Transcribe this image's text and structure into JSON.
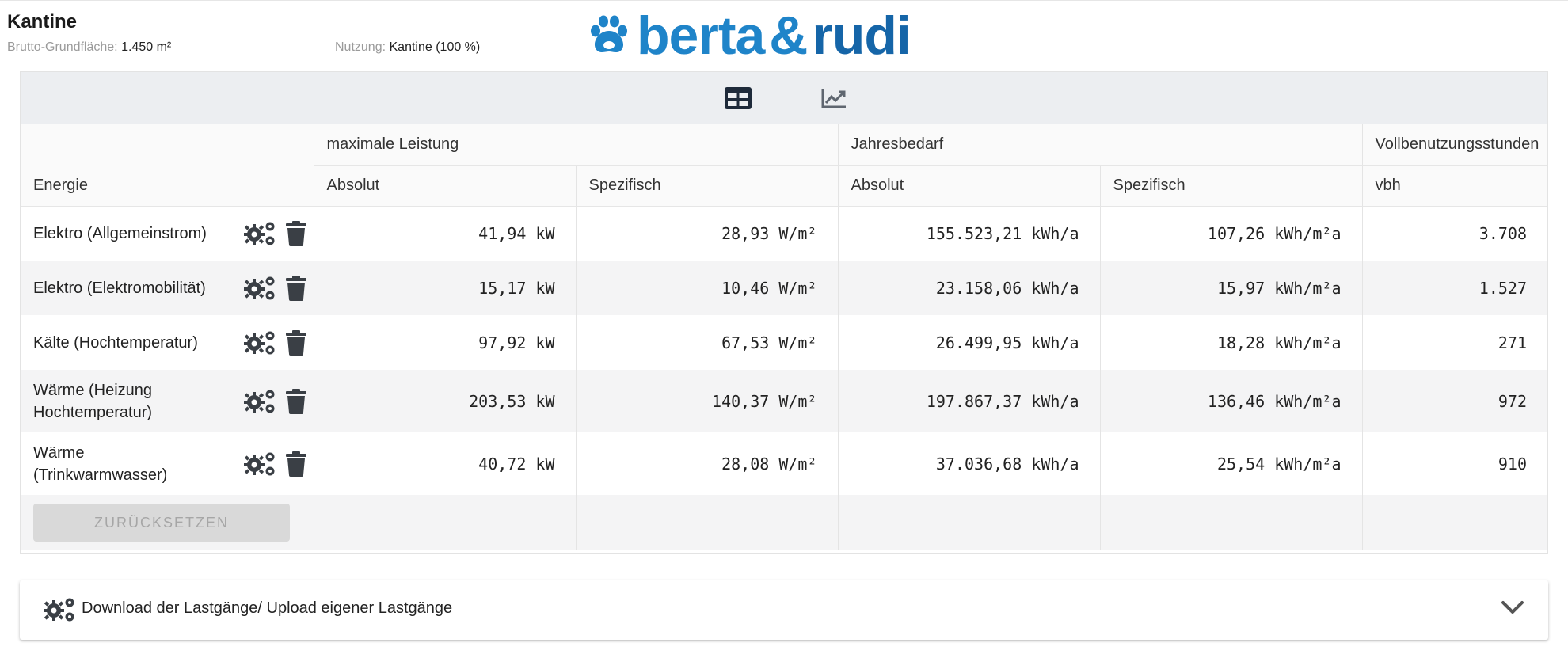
{
  "building": {
    "title": "Kantine",
    "area_label": "Brutto-Grundfläche:",
    "area_value": "1.450 m²",
    "usage_label": "Nutzung:",
    "usage_value": "Kantine (100 %)"
  },
  "logo": {
    "part1": "berta",
    "amp": "&",
    "part2": "rudi",
    "color": "#1f84c9"
  },
  "toolbar": {
    "table_icon": "table-icon",
    "chart_icon": "line-chart-icon",
    "active": "table"
  },
  "table": {
    "group_headers": {
      "energy": "Energie",
      "max_power": "maximale Leistung",
      "annual": "Jahresbedarf",
      "full_hours": "Vollbenutzungsstunden"
    },
    "sub_headers": {
      "abs1": "Absolut",
      "spec1": "Spezifisch",
      "abs2": "Absolut",
      "spec2": "Spezifisch",
      "vbh": "vbh"
    },
    "rows": [
      {
        "name": "Elektro (Allgemeinstrom)",
        "p_abs": "41,94 kW",
        "p_spec": "28,93 W/m²",
        "a_abs": "155.523,21 kWh/a",
        "a_spec": "107,26 kWh/m²a",
        "vbh": "3.708"
      },
      {
        "name": "Elektro (Elektromobilität)",
        "p_abs": "15,17 kW",
        "p_spec": "10,46 W/m²",
        "a_abs": "23.158,06 kWh/a",
        "a_spec": "15,97 kWh/m²a",
        "vbh": "1.527"
      },
      {
        "name": "Kälte (Hochtemperatur)",
        "p_abs": "97,92 kW",
        "p_spec": "67,53 W/m²",
        "a_abs": "26.499,95 kWh/a",
        "a_spec": "18,28 kWh/m²a",
        "vbh": "271"
      },
      {
        "name": "Wärme (Heizung Hochtemperatur)",
        "p_abs": "203,53 kW",
        "p_spec": "140,37 W/m²",
        "a_abs": "197.867,37 kWh/a",
        "a_spec": "136,46 kWh/m²a",
        "vbh": "972"
      },
      {
        "name": "Wärme (Trinkwarmwasser)",
        "p_abs": "40,72 kW",
        "p_spec": "28,08 W/m²",
        "a_abs": "37.036,68 kWh/a",
        "a_spec": "25,54 kWh/m²a",
        "vbh": "910"
      }
    ],
    "reset_label": "ZURÜCKSETZEN"
  },
  "accordion": {
    "label": "Download der Lastgänge/ Upload eigener Lastgänge"
  },
  "colors": {
    "icon": "#3a3f45",
    "toolbar_bg": "#eceef1",
    "row_alt": "#f4f4f5"
  }
}
